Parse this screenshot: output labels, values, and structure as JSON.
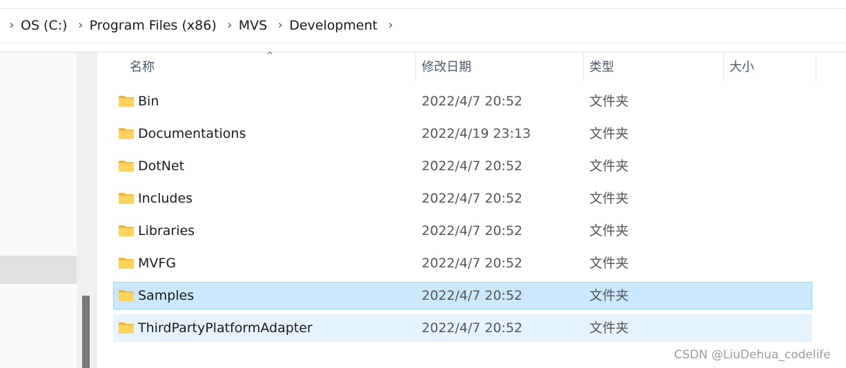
{
  "breadcrumb": {
    "items": [
      "OS (C:)",
      "Program Files (x86)",
      "MVS",
      "Development"
    ]
  },
  "columns": {
    "name": "名称",
    "modified": "修改日期",
    "type": "类型",
    "size": "大小"
  },
  "sort": {
    "column": "name",
    "direction": "ascending",
    "indicator_icon": "sort-ascending-icon"
  },
  "files": [
    {
      "name": "Bin",
      "modified": "2022/4/7 20:52",
      "type": "文件夹",
      "icon": "folder-icon",
      "state": "normal"
    },
    {
      "name": "Documentations",
      "modified": "2022/4/19 23:13",
      "type": "文件夹",
      "icon": "folder-icon",
      "state": "normal"
    },
    {
      "name": "DotNet",
      "modified": "2022/4/7 20:52",
      "type": "文件夹",
      "icon": "folder-icon",
      "state": "normal"
    },
    {
      "name": "Includes",
      "modified": "2022/4/7 20:52",
      "type": "文件夹",
      "icon": "folder-icon",
      "state": "normal"
    },
    {
      "name": "Libraries",
      "modified": "2022/4/7 20:52",
      "type": "文件夹",
      "icon": "folder-icon",
      "state": "normal"
    },
    {
      "name": "MVFG",
      "modified": "2022/4/7 20:52",
      "type": "文件夹",
      "icon": "folder-icon",
      "state": "normal"
    },
    {
      "name": "Samples",
      "modified": "2022/4/7 20:52",
      "type": "文件夹",
      "icon": "folder-icon",
      "state": "selected"
    },
    {
      "name": "ThirdPartyPlatformAdapter",
      "modified": "2022/4/7 20:52",
      "type": "文件夹",
      "icon": "folder-icon",
      "state": "hover"
    }
  ],
  "watermark": "CSDN @LiuDehua_codelife",
  "colors": {
    "selected_bg": "#cce8ff",
    "selected_border": "#99d1ff",
    "hover_bg": "#e5f3ff",
    "folder_yellow": "#ffd35e"
  }
}
